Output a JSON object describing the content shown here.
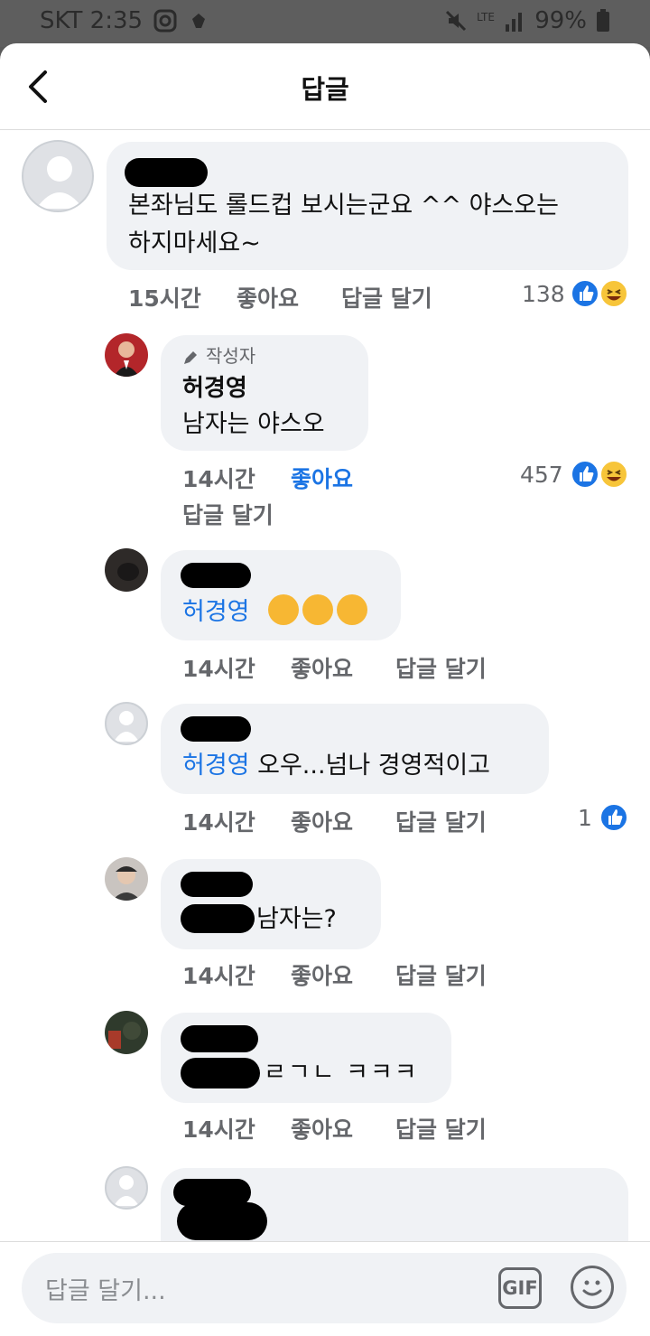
{
  "status_bar": {
    "carrier_time": "SKT 2:35",
    "battery": "99%"
  },
  "header": {
    "title": "답글"
  },
  "comments": [
    {
      "text_lines": [
        "본좌님도 롤드컵 보시는군요 ^^ 야스오는",
        "하지마세요~"
      ],
      "time": "15시간",
      "like": "좋아요",
      "reply": "답글 달기",
      "reactions": "138"
    },
    {
      "author_tag": "작성자",
      "author": "허경영",
      "text": "남자는 야스오",
      "time": "14시간",
      "like": "좋아요",
      "reply": "답글 달기",
      "reactions": "457"
    },
    {
      "mention": "허경영",
      "time": "14시간",
      "like": "좋아요",
      "reply": "답글 달기"
    },
    {
      "mention": "허경영",
      "text": " 오우...넘나 경영적이고",
      "time": "14시간",
      "like": "좋아요",
      "reply": "답글 달기",
      "reactions": "1"
    },
    {
      "text": " 남자는?",
      "time": "14시간",
      "like": "좋아요",
      "reply": "답글 달기"
    },
    {
      "text": "ㄹㄱㄴ ㅋㅋㅋ",
      "time": "14시간",
      "like": "좋아요",
      "reply": "답글 달기"
    }
  ],
  "composer": {
    "placeholder": "답글 달기...",
    "gif_label": "GIF"
  },
  "colors": {
    "link_blue": "#1b74e4",
    "bubble_bg": "#f0f2f5",
    "meta_gray": "#65676b"
  }
}
